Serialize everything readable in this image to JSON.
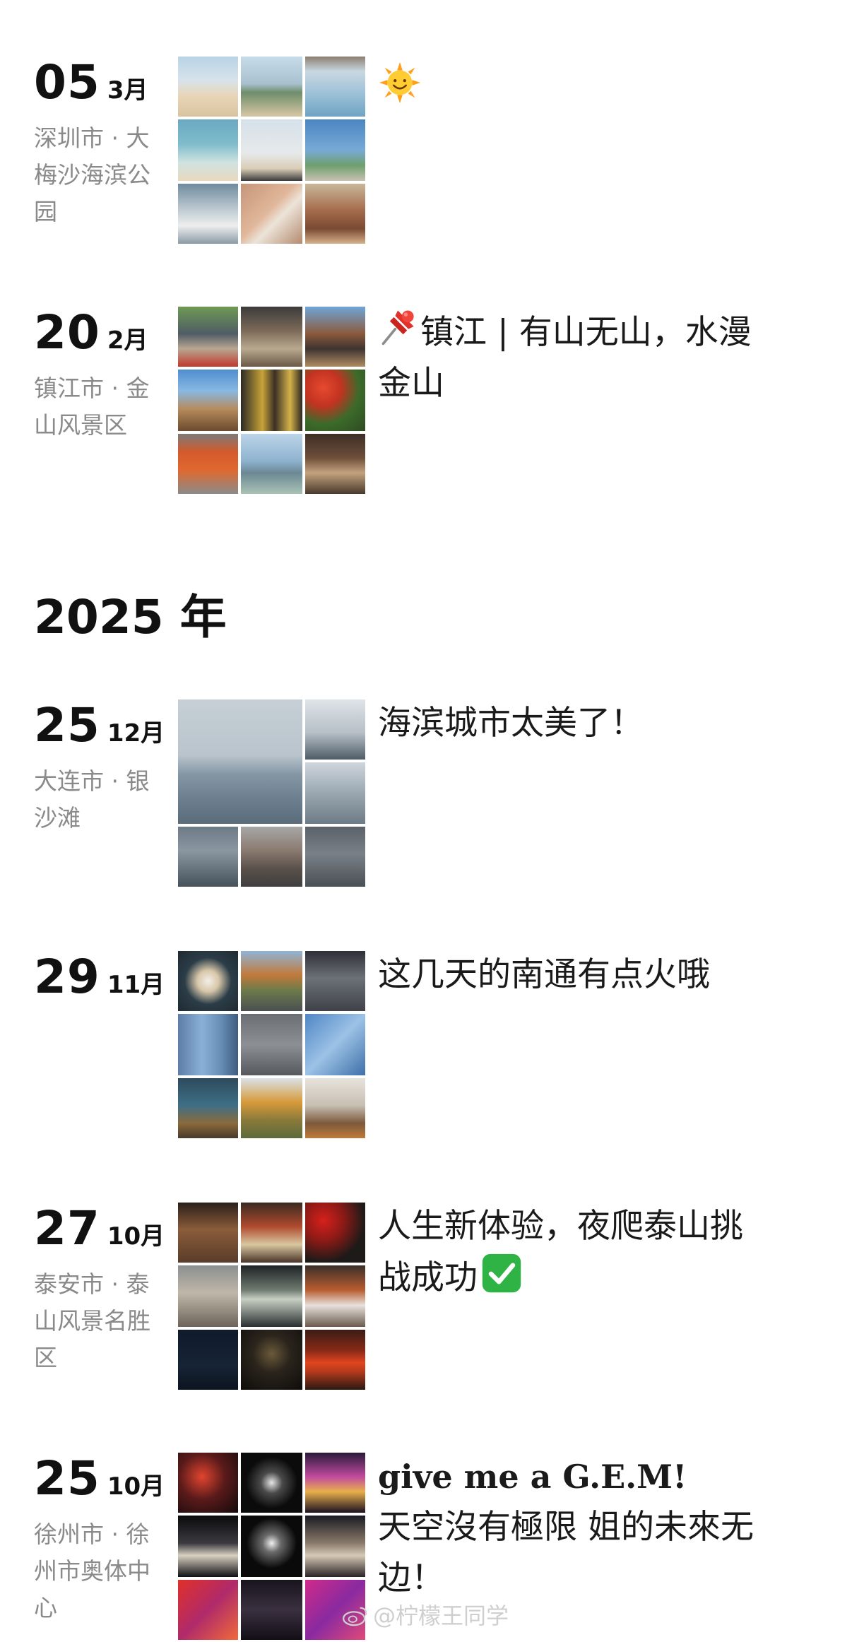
{
  "posts_2026": [
    {
      "day": "05",
      "month": "3月",
      "location": "深圳市 · 大梅沙海滨公园",
      "caption_lines": [
        ""
      ],
      "emoji": "sun-emoji",
      "photo_count": 9
    },
    {
      "day": "20",
      "month": "2月",
      "location": "镇江市 · 金山风景区",
      "caption_lines": [
        "镇江 | 有山无山，水漫",
        "金山"
      ],
      "emoji": "pushpin-emoji",
      "photo_count": 9
    }
  ],
  "year_heading": "2025 年",
  "posts_2025": [
    {
      "day": "25",
      "month": "12月",
      "location": "大连市 · 银沙滩",
      "caption_lines": [
        "海滨城市太美了！"
      ],
      "photo_count": 6
    },
    {
      "day": "29",
      "month": "11月",
      "location": "",
      "caption_lines": [
        "这几天的南通有点火哦"
      ],
      "photo_count": 9
    },
    {
      "day": "27",
      "month": "10月",
      "location": "泰安市 · 泰山风景名胜区",
      "caption_lines": [
        "人生新体验，夜爬泰山挑",
        "战成功"
      ],
      "emoji": "check-mark-emoji",
      "photo_count": 9
    },
    {
      "day": "25",
      "month": "10月",
      "location": "徐州市 · 徐州市奥体中心",
      "caption_lines": [
        "give me a G.E.M!",
        "天空沒有極限 姐的未來无",
        "边！"
      ],
      "photo_count": 9
    }
  ],
  "watermark": "@柠檬王同学",
  "colors": {
    "text": "#1a1a1a",
    "location_text": "#8a8a8a",
    "background": "#ffffff",
    "check_green": "#2fb344",
    "pin_red": "#e0312b",
    "sun_yellow": "#ffcc33"
  }
}
